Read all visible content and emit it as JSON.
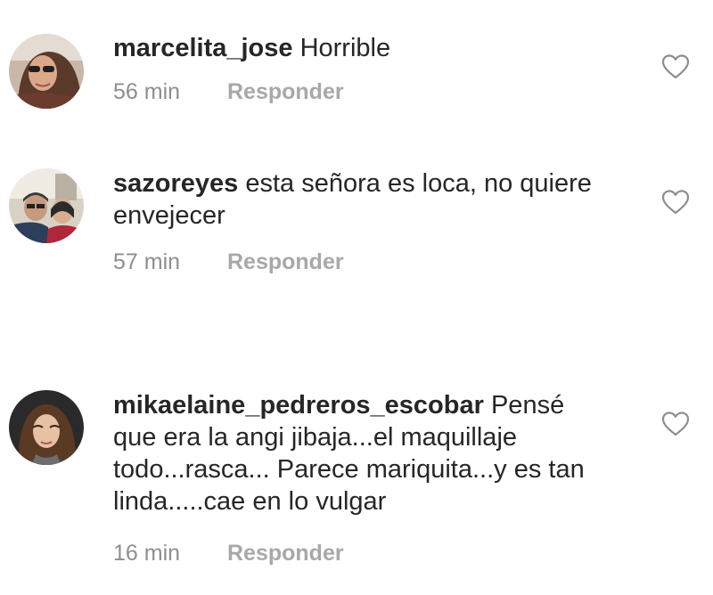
{
  "comments": [
    {
      "username": "marcelita_jose",
      "text": "Horrible",
      "time": "56 min",
      "reply_label": "Responder",
      "avatar_icon": "user-avatar-sunglasses",
      "like_icon": "heart-outline-icon"
    },
    {
      "username": "sazoreyes",
      "text": "esta señora es loca, no quiere envejecer",
      "time": "57 min",
      "reply_label": "Responder",
      "avatar_icon": "user-avatar-group",
      "like_icon": "heart-outline-icon"
    },
    {
      "username": "mikaelaine_pedreros_escobar",
      "text": "Pensé que era la angi jibaja...el maquillaje todo...rasca... Parece mariquita...y es tan linda.....cae en lo vulgar",
      "time": "16 min",
      "reply_label": "Responder",
      "avatar_icon": "user-avatar-portrait",
      "like_icon": "heart-outline-icon"
    }
  ],
  "colors": {
    "text": "#262626",
    "meta": "#8e8e8e",
    "reply": "#a8a8a8",
    "heart": "#8e8e8e"
  }
}
